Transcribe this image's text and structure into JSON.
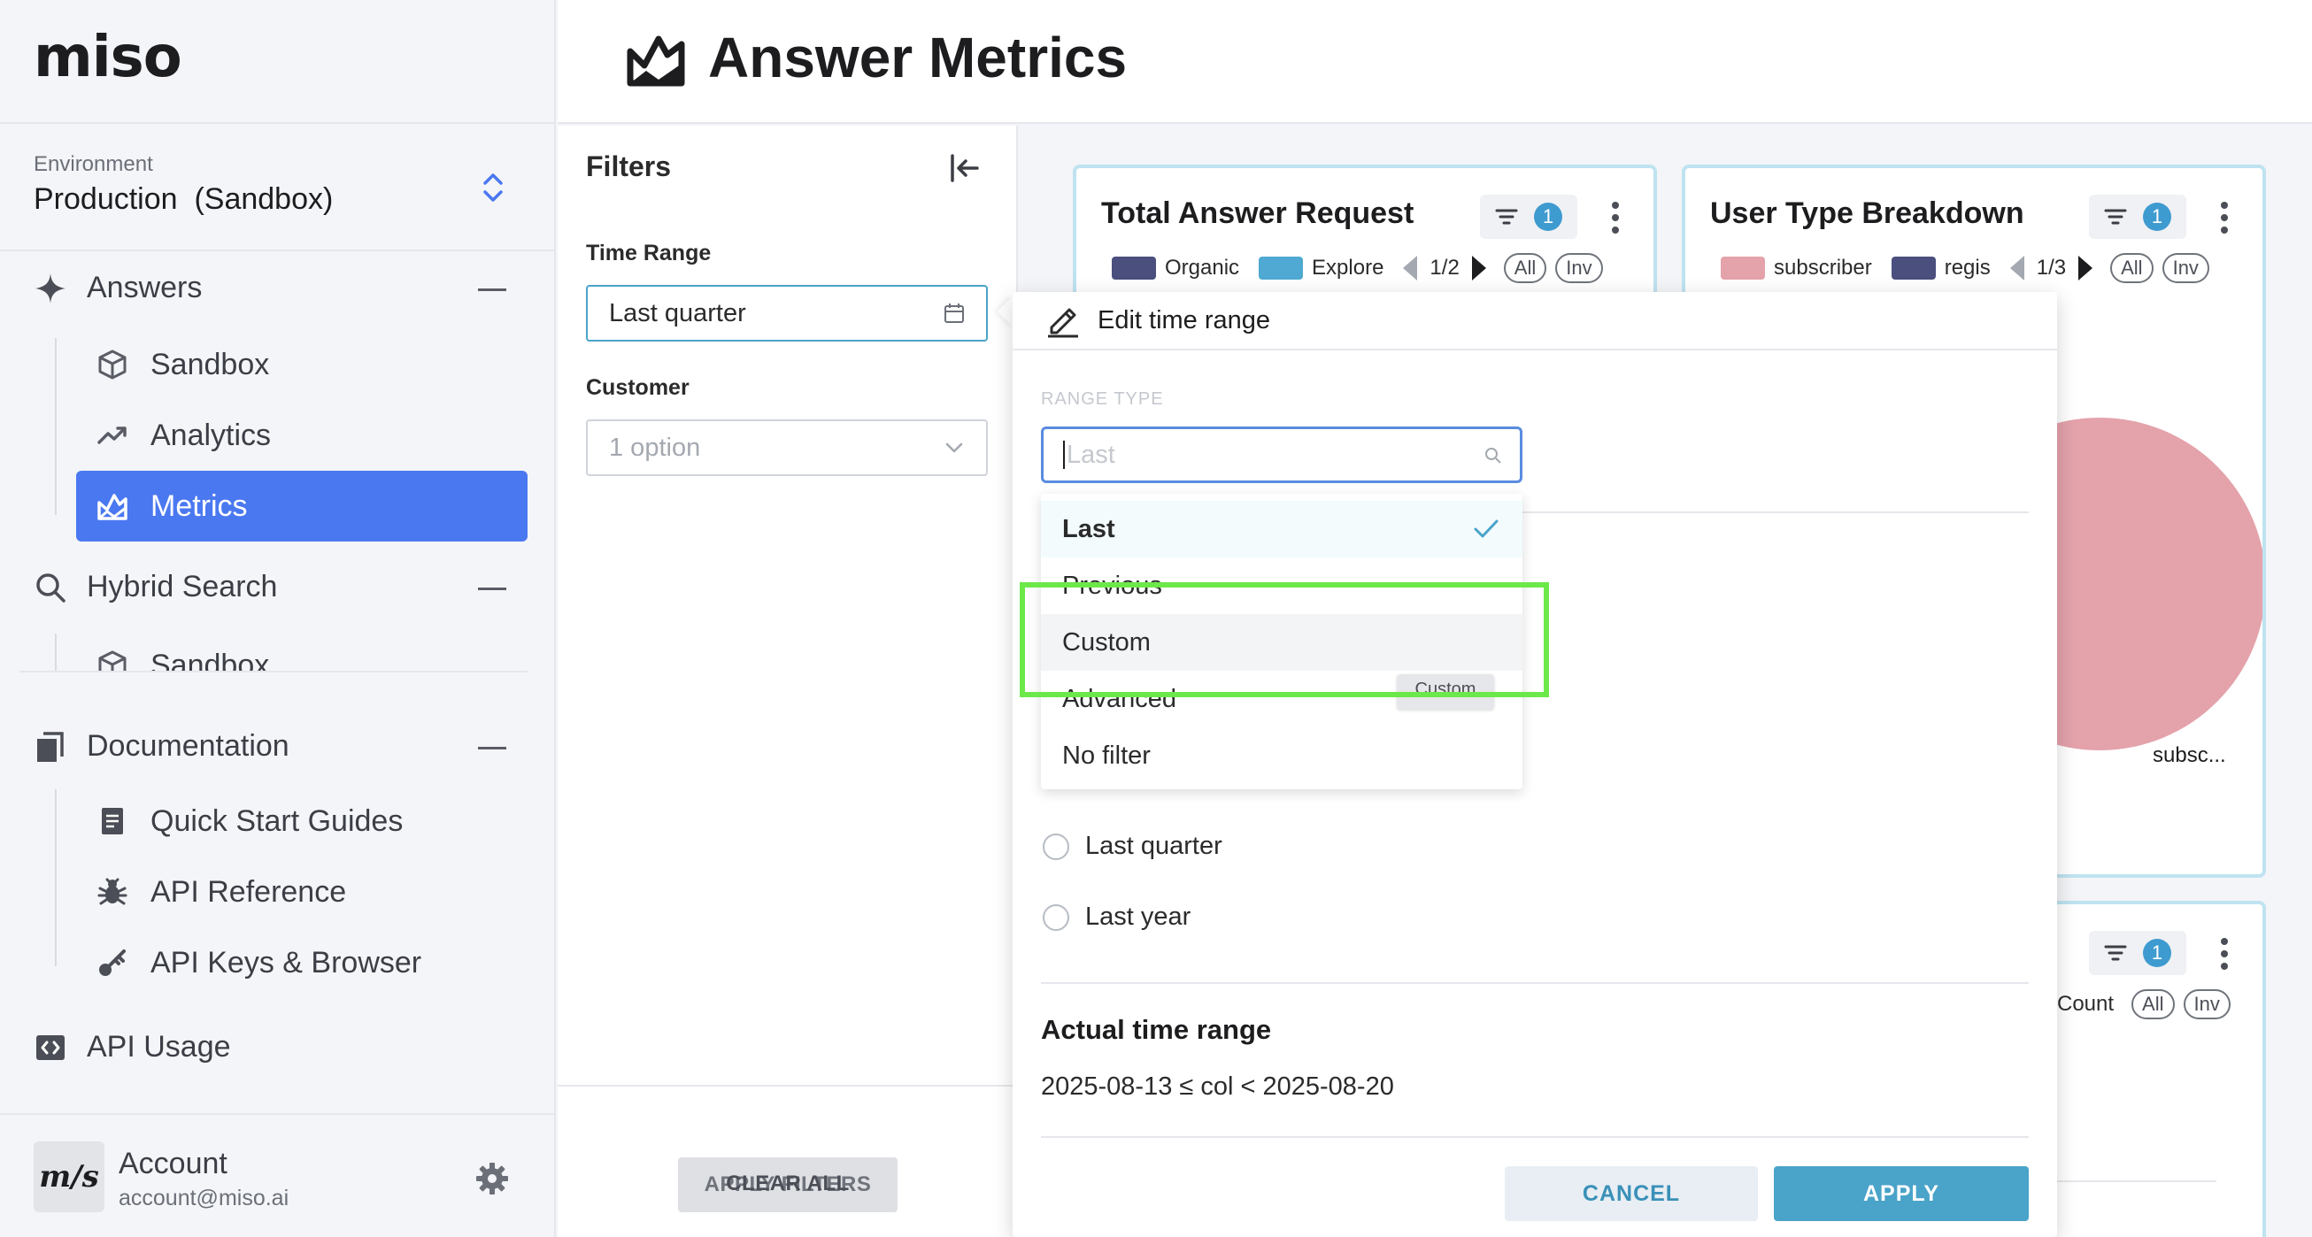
{
  "app": {
    "logo": "miso"
  },
  "header": {
    "title": "Answer Metrics",
    "icon": "chart-mountain-icon"
  },
  "sidebar": {
    "environment_label": "Environment",
    "environment_value": "Production  (Sandbox)",
    "sections": [
      {
        "label": "Answers",
        "icon": "sparkle-icon",
        "items": [
          {
            "label": "Sandbox",
            "icon": "cube-icon"
          },
          {
            "label": "Analytics",
            "icon": "trend-icon"
          },
          {
            "label": "Metrics",
            "icon": "chart-mountain-icon",
            "active": true
          }
        ]
      },
      {
        "label": "Hybrid Search",
        "icon": "search-icon",
        "items": [
          {
            "label": "Sandbox",
            "icon": "cube-icon"
          }
        ]
      },
      {
        "label": "Documentation",
        "icon": "docs-icon",
        "items": [
          {
            "label": "Quick Start Guides",
            "icon": "document-icon"
          },
          {
            "label": "API Reference",
            "icon": "bug-icon"
          },
          {
            "label": "API Keys & Browser",
            "icon": "key-icon"
          }
        ]
      },
      {
        "label": "API Usage",
        "icon": "code-icon",
        "items": []
      }
    ],
    "account": {
      "name": "Account",
      "email": "account@miso.ai",
      "avatar_text": "m/s"
    }
  },
  "filters": {
    "title": "Filters",
    "time_range_label": "Time Range",
    "time_range_value": "Last quarter",
    "customer_label": "Customer",
    "customer_placeholder": "1 option",
    "apply_label": "APPLY FILTERS",
    "clear_label": "CLEAR ALL"
  },
  "cards": [
    {
      "title": "Total Answer Request",
      "filter_count": "1",
      "legend": [
        {
          "label": "Organic",
          "color": "#4a4f7d"
        },
        {
          "label": "Explore",
          "color": "#4fa9d2"
        }
      ],
      "page": "1/2",
      "all_label": "All",
      "inv_label": "Inv"
    },
    {
      "title": "User Type Breakdown",
      "filter_count": "1",
      "legend": [
        {
          "label": "subscriber",
          "color": "#e4a2ab"
        },
        {
          "label": "regis",
          "color": "#4a4f7d"
        }
      ],
      "page": "1/3",
      "all_label": "All",
      "inv_label": "Inv",
      "pie_label": "subsc..."
    },
    {
      "title": "",
      "filter_count": "1",
      "legend_partial": "Count",
      "all_label": "All",
      "inv_label": "Inv"
    }
  ],
  "popup": {
    "title": "Edit time range",
    "range_type_label": "RANGE TYPE",
    "range_type_placeholder": "Last",
    "options": [
      "Last",
      "Previous",
      "Custom",
      "Advanced",
      "No filter"
    ],
    "selected_option": "Last",
    "hovered_option": "Custom",
    "tooltip": "Custom",
    "radios": [
      "Last quarter",
      "Last year"
    ],
    "actual_time_range_label": "Actual time range",
    "actual_time_range_value": "2025-08-13 ≤ col < 2025-08-20",
    "cancel_label": "CANCEL",
    "apply_label": "APPLY"
  },
  "colors": {
    "accent": "#4a78f0",
    "teal": "#4aa3c9",
    "highlight": "#6de84a",
    "card_border": "#bfe3f0",
    "pie": "#e4a2ab"
  }
}
